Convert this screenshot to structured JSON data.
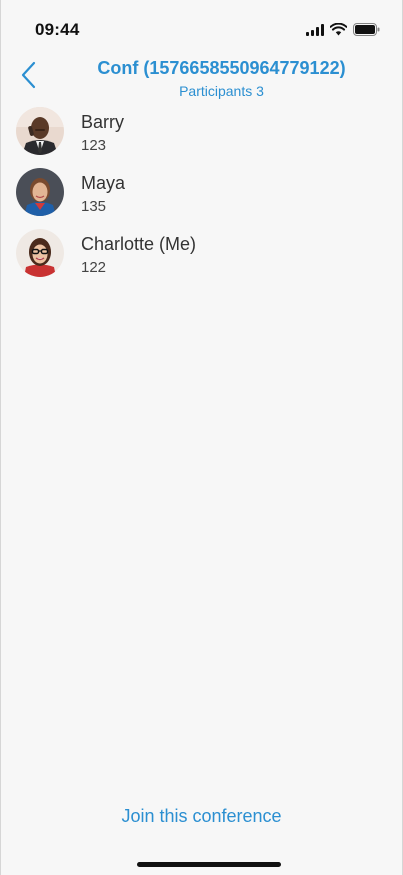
{
  "status_bar": {
    "time": "09:44",
    "icons": [
      "cellular-signal-icon",
      "wifi-icon",
      "battery-icon"
    ]
  },
  "header": {
    "back_icon": "chevron-left-icon",
    "title": "Conf (1576658550964779122)",
    "subtitle": "Participants 3"
  },
  "participants": [
    {
      "name": "Barry",
      "number": "123",
      "avatar": "avatar-photo"
    },
    {
      "name": "Maya",
      "number": "135",
      "avatar": "avatar-photo"
    },
    {
      "name": "Charlotte (Me)",
      "number": "122",
      "avatar": "avatar-photo"
    }
  ],
  "actions": {
    "join_label": "Join this conference"
  },
  "colors": {
    "accent": "#2b8fd1",
    "background": "#f7f7f7",
    "text": "#333333"
  }
}
